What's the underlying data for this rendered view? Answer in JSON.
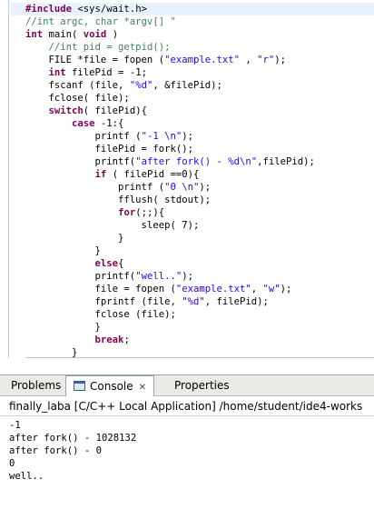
{
  "editor": {
    "lines": [
      [
        {
          "t": "#include",
          "c": "pp"
        },
        {
          "t": " <sys/wait.h>",
          "c": ""
        }
      ],
      [
        {
          "t": "//int argc, char *argv[] \"",
          "c": "cm"
        }
      ],
      [
        {
          "t": "int",
          "c": "kw"
        },
        {
          "t": " main( ",
          "c": ""
        },
        {
          "t": "void",
          "c": "kw"
        },
        {
          "t": " )",
          "c": ""
        }
      ],
      [
        {
          "t": "    ",
          "c": ""
        },
        {
          "t": "//int pid = getpid();",
          "c": "cm"
        }
      ],
      [
        {
          "t": "    FILE *file = fopen (",
          "c": ""
        },
        {
          "t": "\"example.txt\"",
          "c": "str"
        },
        {
          "t": " , ",
          "c": ""
        },
        {
          "t": "\"r\"",
          "c": "str"
        },
        {
          "t": ");",
          "c": ""
        }
      ],
      [
        {
          "t": "    ",
          "c": ""
        },
        {
          "t": "int",
          "c": "kw"
        },
        {
          "t": " filePid = -1;",
          "c": ""
        }
      ],
      [
        {
          "t": "    fscanf (file, ",
          "c": ""
        },
        {
          "t": "\"%d\"",
          "c": "str"
        },
        {
          "t": ", &filePid);",
          "c": ""
        }
      ],
      [
        {
          "t": "    fclose( file);",
          "c": ""
        }
      ],
      [
        {
          "t": "    ",
          "c": ""
        },
        {
          "t": "switch",
          "c": "kw"
        },
        {
          "t": "( filePid){",
          "c": ""
        }
      ],
      [
        {
          "t": "        ",
          "c": ""
        },
        {
          "t": "case",
          "c": "kw"
        },
        {
          "t": " -1:{",
          "c": ""
        }
      ],
      [
        {
          "t": "            printf (",
          "c": ""
        },
        {
          "t": "\"-1 \\n\"",
          "c": "str"
        },
        {
          "t": ");",
          "c": ""
        }
      ],
      [
        {
          "t": "            filePid = fork();",
          "c": ""
        }
      ],
      [
        {
          "t": "            printf(",
          "c": ""
        },
        {
          "t": "\"after fork() - %d\\n\"",
          "c": "str"
        },
        {
          "t": ",filePid);",
          "c": ""
        }
      ],
      [
        {
          "t": "            ",
          "c": ""
        },
        {
          "t": "if",
          "c": "kw"
        },
        {
          "t": " ( filePid ==0){",
          "c": ""
        }
      ],
      [
        {
          "t": "                printf (",
          "c": ""
        },
        {
          "t": "\"0 \\n\"",
          "c": "str"
        },
        {
          "t": ");",
          "c": ""
        }
      ],
      [
        {
          "t": "                fflush( stdout);",
          "c": ""
        }
      ],
      [
        {
          "t": "                ",
          "c": ""
        },
        {
          "t": "for",
          "c": "kw"
        },
        {
          "t": "(;;){",
          "c": ""
        }
      ],
      [
        {
          "t": "                    sleep( 7);",
          "c": ""
        }
      ],
      [
        {
          "t": "                }",
          "c": ""
        }
      ],
      [
        {
          "t": "            }",
          "c": ""
        }
      ],
      [
        {
          "t": "            ",
          "c": ""
        },
        {
          "t": "else",
          "c": "kw"
        },
        {
          "t": "{",
          "c": ""
        }
      ],
      [
        {
          "t": "            printf(",
          "c": ""
        },
        {
          "t": "\"well..\"",
          "c": "str"
        },
        {
          "t": ");",
          "c": ""
        }
      ],
      [
        {
          "t": "            file = fopen (",
          "c": ""
        },
        {
          "t": "\"example.txt\"",
          "c": "str"
        },
        {
          "t": ", ",
          "c": ""
        },
        {
          "t": "\"w\"",
          "c": "str"
        },
        {
          "t": ");",
          "c": ""
        }
      ],
      [
        {
          "t": "            fprintf (file, ",
          "c": ""
        },
        {
          "t": "\"%d\"",
          "c": "str"
        },
        {
          "t": ", filePid);",
          "c": ""
        }
      ],
      [
        {
          "t": "            fclose (file);",
          "c": ""
        }
      ],
      [
        {
          "t": "            }",
          "c": ""
        }
      ],
      [
        {
          "t": "            ",
          "c": ""
        },
        {
          "t": "break",
          "c": "kw"
        },
        {
          "t": ";",
          "c": ""
        }
      ],
      [
        {
          "t": "        }",
          "c": ""
        }
      ]
    ],
    "highlight_line_index": 0
  },
  "views": {
    "tabs": {
      "problems": "Problems",
      "console": "Console",
      "console_close": "✕",
      "properties": "Properties"
    },
    "console_title": "finally_laba [C/C++ Local Application] /home/student/ide4-works",
    "console_output": [
      "-1",
      "after fork() - 1028132",
      "after fork() - 0",
      "0",
      "well.."
    ]
  },
  "colors": {
    "keyword": "#7f0055",
    "string": "#2a00ff",
    "comment": "#3f7f5f",
    "current_line": "#e8f2fe"
  }
}
